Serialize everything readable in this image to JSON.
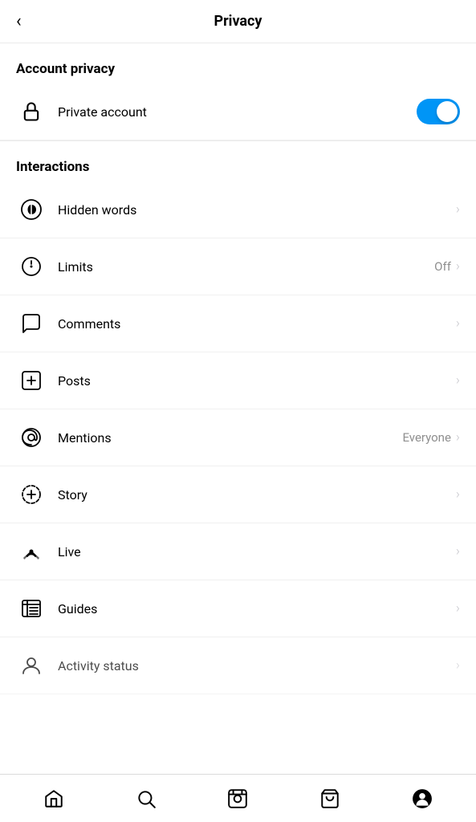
{
  "header": {
    "back_label": "‹",
    "title": "Privacy"
  },
  "account_privacy": {
    "section_title": "Account privacy",
    "private_account": {
      "label": "Private account",
      "toggle_on": true
    }
  },
  "interactions": {
    "section_title": "Interactions",
    "items": [
      {
        "id": "hidden-words",
        "label": "Hidden words",
        "value": "",
        "icon": "filter"
      },
      {
        "id": "limits",
        "label": "Limits",
        "value": "Off",
        "icon": "limits"
      },
      {
        "id": "comments",
        "label": "Comments",
        "value": "",
        "icon": "comment"
      },
      {
        "id": "posts",
        "label": "Posts",
        "value": "",
        "icon": "posts"
      },
      {
        "id": "mentions",
        "label": "Mentions",
        "value": "Everyone",
        "icon": "mention"
      },
      {
        "id": "story",
        "label": "Story",
        "value": "",
        "icon": "story"
      },
      {
        "id": "live",
        "label": "Live",
        "value": "",
        "icon": "live"
      },
      {
        "id": "guides",
        "label": "Guides",
        "value": "",
        "icon": "guides"
      },
      {
        "id": "activity-status",
        "label": "Activity status",
        "value": "",
        "icon": "activity"
      }
    ]
  },
  "bottom_nav": {
    "items": [
      {
        "id": "home",
        "label": "Home",
        "icon": "home"
      },
      {
        "id": "search",
        "label": "Search",
        "icon": "search"
      },
      {
        "id": "reels",
        "label": "Reels",
        "icon": "reels"
      },
      {
        "id": "shop",
        "label": "Shop",
        "icon": "shop"
      },
      {
        "id": "profile",
        "label": "Profile",
        "icon": "profile"
      }
    ]
  }
}
